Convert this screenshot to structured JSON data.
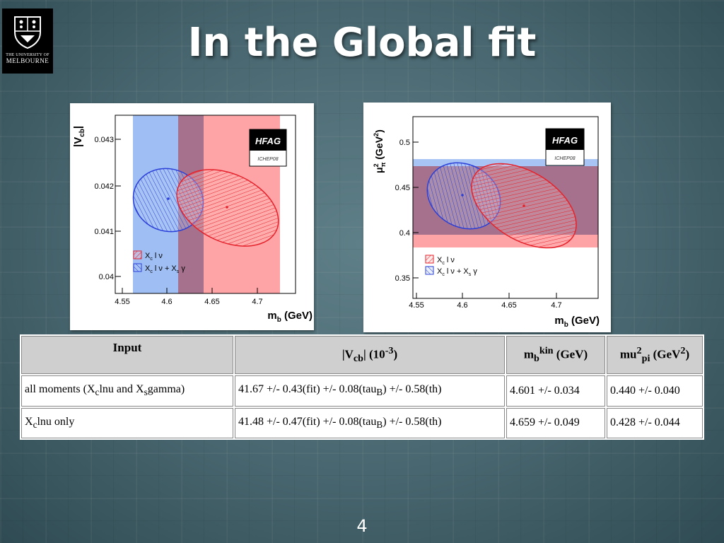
{
  "logo": {
    "line1": "THE UNIVERSITY OF",
    "line2": "MELBOURNE"
  },
  "slide": {
    "title": "In the Global fit",
    "page_number": "4"
  },
  "colors": {
    "red_band": "#ff9ea0",
    "blue_band": "#8fb4f2",
    "overlap": "#a06a86",
    "red_ellipse": "#e5222b",
    "blue_ellipse": "#2a3fd8"
  },
  "chart_data": [
    {
      "type": "scatter",
      "ylabel_main": "|V",
      "ylabel_sub": "cb",
      "ylabel_end": "|",
      "xlabel_main": "m",
      "xlabel_sub": "b",
      "xlabel_end": " (GeV)",
      "xticks": [
        "4.55",
        "4.6",
        "4.65",
        "4.7"
      ],
      "yticks": [
        "0.04",
        "0.041",
        "0.042",
        "0.043"
      ],
      "badge": {
        "top": "HFAG",
        "bottom": "ICHEP08"
      },
      "legend": [
        {
          "label": "X",
          "sub": "c",
          "rest": " l ν"
        },
        {
          "label": "X",
          "sub": "c",
          "rest": " l ν + X",
          "sub2": "s",
          "rest2": " γ"
        }
      ],
      "series": [
        {
          "center_x": 4.659,
          "center_y": 0.04148
        },
        {
          "center_x": 4.601,
          "center_y": 0.04167
        }
      ]
    },
    {
      "type": "scatter",
      "ylabel_main": "μ",
      "ylabel_sup": "2",
      "ylabel_sub": "π",
      "ylabel_end": " (GeV",
      "ylabel_sup2": "2",
      "ylabel_close": ")",
      "xlabel_main": "m",
      "xlabel_sub": "b",
      "xlabel_end": " (GeV)",
      "xticks": [
        "4.55",
        "4.6",
        "4.65",
        "4.7"
      ],
      "yticks": [
        "0.35",
        "0.4",
        "0.45",
        "0.5"
      ],
      "badge": {
        "top": "HFAG",
        "bottom": "ICHEP08"
      },
      "legend": [
        {
          "label": "X",
          "sub": "c",
          "rest": " l ν"
        },
        {
          "label": "X",
          "sub": "c",
          "rest": " l ν + X",
          "sub2": "s",
          "rest2": " γ"
        }
      ],
      "series": [
        {
          "center_x": 4.66,
          "center_y": 0.428
        },
        {
          "center_x": 4.6,
          "center_y": 0.44
        }
      ]
    }
  ],
  "table": {
    "headers": [
      {
        "a": "Input"
      },
      {
        "a": "|V",
        "sub": "cb",
        "b": "| (10",
        "sup": "-3",
        "c": ")"
      },
      {
        "a": "m",
        "sub": "b",
        "sup": "kin",
        "c": " (GeV)"
      },
      {
        "a": "mu",
        "sup": "2",
        "sub": "pi",
        "c": " (GeV",
        "sup2": "2",
        "d": ")"
      }
    ],
    "rows": [
      {
        "input": {
          "a": "all moments (X",
          "sub": "c",
          "b": "lnu and X",
          "sub2": "s",
          "c": "gamma)"
        },
        "vcb": {
          "a": "41.67 +/- 0.43(fit) +/- 0.08(tau",
          "sub": "B",
          "b": ") +/- 0.58(th)"
        },
        "mb": "4.601 +/- 0.034",
        "mu": "0.440 +/- 0.040"
      },
      {
        "input": {
          "a": "X",
          "sub": "c",
          "b": "lnu only"
        },
        "vcb": {
          "a": "41.48 +/- 0.47(fit) +/- 0.08(tau",
          "sub": "B",
          "b": ") +/- 0.58(th)"
        },
        "mb": "4.659 +/- 0.049",
        "mu": "0.428 +/- 0.044"
      }
    ]
  }
}
